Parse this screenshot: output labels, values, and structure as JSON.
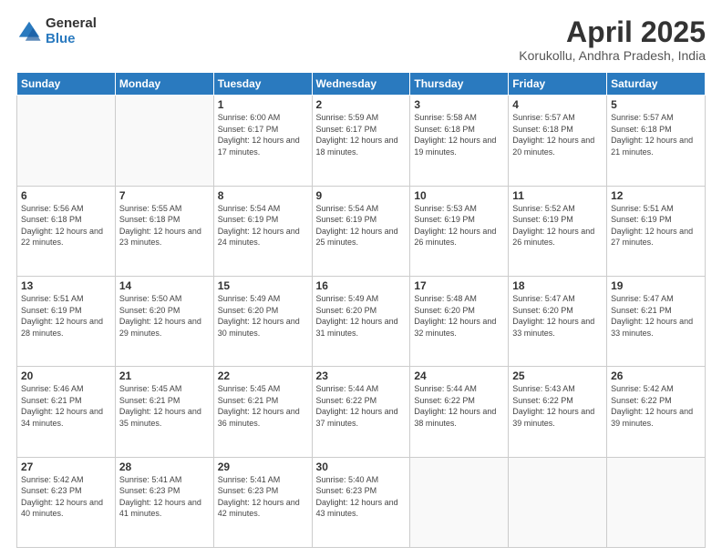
{
  "header": {
    "logo_general": "General",
    "logo_blue": "Blue",
    "title": "April 2025",
    "subtitle": "Korukollu, Andhra Pradesh, India"
  },
  "days_of_week": [
    "Sunday",
    "Monday",
    "Tuesday",
    "Wednesday",
    "Thursday",
    "Friday",
    "Saturday"
  ],
  "weeks": [
    [
      {
        "day": "",
        "info": ""
      },
      {
        "day": "",
        "info": ""
      },
      {
        "day": "1",
        "info": "Sunrise: 6:00 AM\nSunset: 6:17 PM\nDaylight: 12 hours and 17 minutes."
      },
      {
        "day": "2",
        "info": "Sunrise: 5:59 AM\nSunset: 6:17 PM\nDaylight: 12 hours and 18 minutes."
      },
      {
        "day": "3",
        "info": "Sunrise: 5:58 AM\nSunset: 6:18 PM\nDaylight: 12 hours and 19 minutes."
      },
      {
        "day": "4",
        "info": "Sunrise: 5:57 AM\nSunset: 6:18 PM\nDaylight: 12 hours and 20 minutes."
      },
      {
        "day": "5",
        "info": "Sunrise: 5:57 AM\nSunset: 6:18 PM\nDaylight: 12 hours and 21 minutes."
      }
    ],
    [
      {
        "day": "6",
        "info": "Sunrise: 5:56 AM\nSunset: 6:18 PM\nDaylight: 12 hours and 22 minutes."
      },
      {
        "day": "7",
        "info": "Sunrise: 5:55 AM\nSunset: 6:18 PM\nDaylight: 12 hours and 23 minutes."
      },
      {
        "day": "8",
        "info": "Sunrise: 5:54 AM\nSunset: 6:19 PM\nDaylight: 12 hours and 24 minutes."
      },
      {
        "day": "9",
        "info": "Sunrise: 5:54 AM\nSunset: 6:19 PM\nDaylight: 12 hours and 25 minutes."
      },
      {
        "day": "10",
        "info": "Sunrise: 5:53 AM\nSunset: 6:19 PM\nDaylight: 12 hours and 26 minutes."
      },
      {
        "day": "11",
        "info": "Sunrise: 5:52 AM\nSunset: 6:19 PM\nDaylight: 12 hours and 26 minutes."
      },
      {
        "day": "12",
        "info": "Sunrise: 5:51 AM\nSunset: 6:19 PM\nDaylight: 12 hours and 27 minutes."
      }
    ],
    [
      {
        "day": "13",
        "info": "Sunrise: 5:51 AM\nSunset: 6:19 PM\nDaylight: 12 hours and 28 minutes."
      },
      {
        "day": "14",
        "info": "Sunrise: 5:50 AM\nSunset: 6:20 PM\nDaylight: 12 hours and 29 minutes."
      },
      {
        "day": "15",
        "info": "Sunrise: 5:49 AM\nSunset: 6:20 PM\nDaylight: 12 hours and 30 minutes."
      },
      {
        "day": "16",
        "info": "Sunrise: 5:49 AM\nSunset: 6:20 PM\nDaylight: 12 hours and 31 minutes."
      },
      {
        "day": "17",
        "info": "Sunrise: 5:48 AM\nSunset: 6:20 PM\nDaylight: 12 hours and 32 minutes."
      },
      {
        "day": "18",
        "info": "Sunrise: 5:47 AM\nSunset: 6:20 PM\nDaylight: 12 hours and 33 minutes."
      },
      {
        "day": "19",
        "info": "Sunrise: 5:47 AM\nSunset: 6:21 PM\nDaylight: 12 hours and 33 minutes."
      }
    ],
    [
      {
        "day": "20",
        "info": "Sunrise: 5:46 AM\nSunset: 6:21 PM\nDaylight: 12 hours and 34 minutes."
      },
      {
        "day": "21",
        "info": "Sunrise: 5:45 AM\nSunset: 6:21 PM\nDaylight: 12 hours and 35 minutes."
      },
      {
        "day": "22",
        "info": "Sunrise: 5:45 AM\nSunset: 6:21 PM\nDaylight: 12 hours and 36 minutes."
      },
      {
        "day": "23",
        "info": "Sunrise: 5:44 AM\nSunset: 6:22 PM\nDaylight: 12 hours and 37 minutes."
      },
      {
        "day": "24",
        "info": "Sunrise: 5:44 AM\nSunset: 6:22 PM\nDaylight: 12 hours and 38 minutes."
      },
      {
        "day": "25",
        "info": "Sunrise: 5:43 AM\nSunset: 6:22 PM\nDaylight: 12 hours and 39 minutes."
      },
      {
        "day": "26",
        "info": "Sunrise: 5:42 AM\nSunset: 6:22 PM\nDaylight: 12 hours and 39 minutes."
      }
    ],
    [
      {
        "day": "27",
        "info": "Sunrise: 5:42 AM\nSunset: 6:23 PM\nDaylight: 12 hours and 40 minutes."
      },
      {
        "day": "28",
        "info": "Sunrise: 5:41 AM\nSunset: 6:23 PM\nDaylight: 12 hours and 41 minutes."
      },
      {
        "day": "29",
        "info": "Sunrise: 5:41 AM\nSunset: 6:23 PM\nDaylight: 12 hours and 42 minutes."
      },
      {
        "day": "30",
        "info": "Sunrise: 5:40 AM\nSunset: 6:23 PM\nDaylight: 12 hours and 43 minutes."
      },
      {
        "day": "",
        "info": ""
      },
      {
        "day": "",
        "info": ""
      },
      {
        "day": "",
        "info": ""
      }
    ]
  ]
}
